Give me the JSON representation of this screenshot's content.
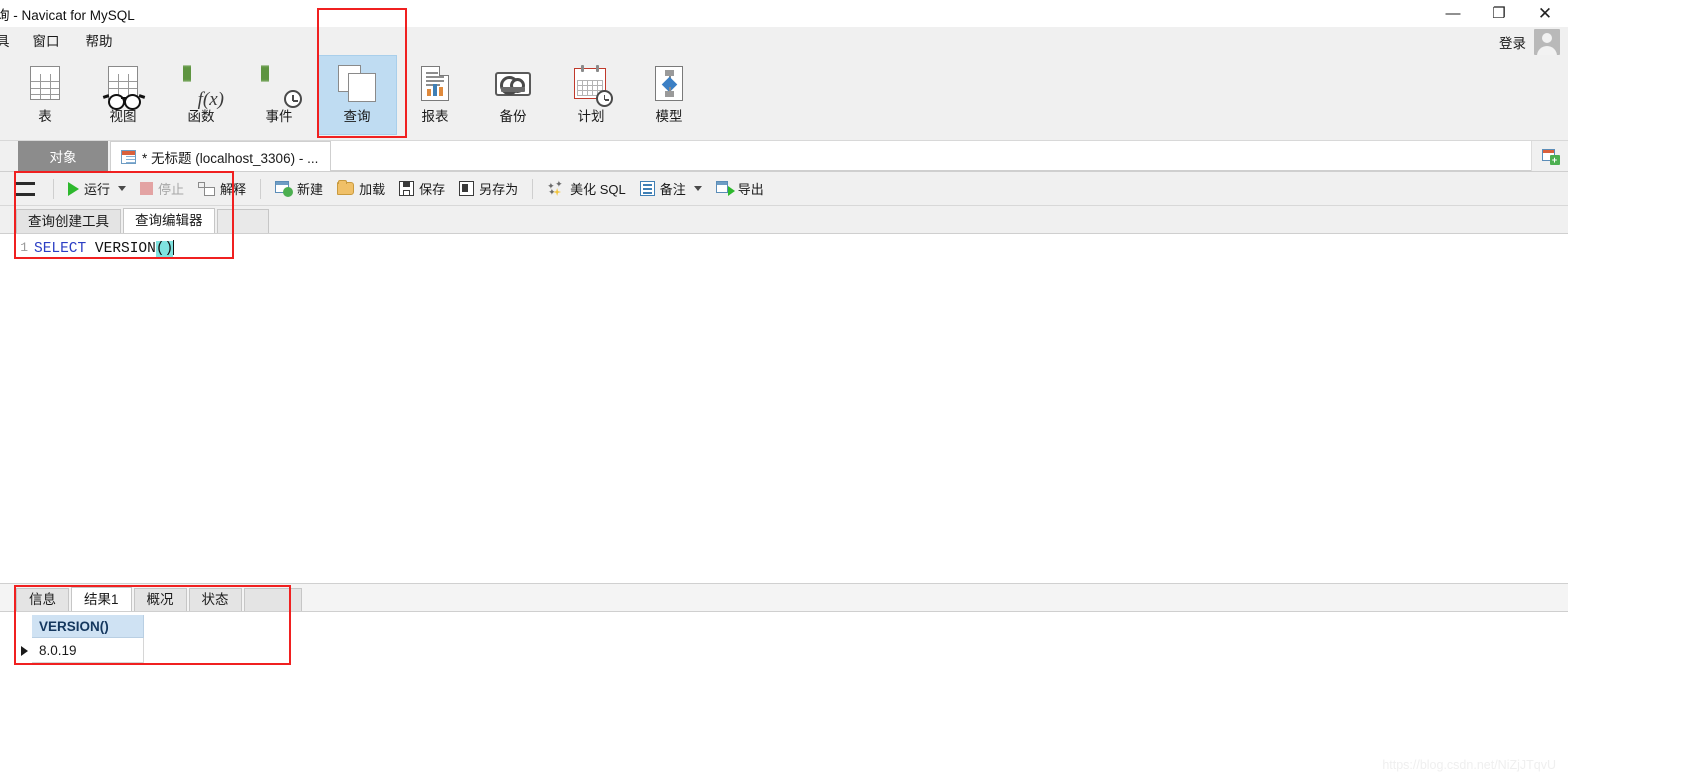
{
  "window": {
    "title": "询 - Navicat for MySQL",
    "minimize_label": "—",
    "maximize_label": "❐",
    "close_label": "✕"
  },
  "menubar": {
    "items": [
      {
        "label": "具"
      },
      {
        "label": "窗口"
      },
      {
        "label": "帮助"
      }
    ],
    "login_label": "登录"
  },
  "toolbar": {
    "items": [
      {
        "label": "表",
        "icon": "table-icon",
        "active": false
      },
      {
        "label": "视图",
        "icon": "view-glasses-icon",
        "active": false
      },
      {
        "label": "函数",
        "icon": "function-icon",
        "active": false
      },
      {
        "label": "事件",
        "icon": "event-clock-icon",
        "active": false
      },
      {
        "label": "查询",
        "icon": "query-icon",
        "active": true
      },
      {
        "label": "报表",
        "icon": "report-icon",
        "active": false
      },
      {
        "label": "备份",
        "icon": "backup-tape-icon",
        "active": false
      },
      {
        "label": "计划",
        "icon": "schedule-calendar-icon",
        "active": false
      },
      {
        "label": "模型",
        "icon": "model-icon",
        "active": false
      }
    ]
  },
  "tabstrip": {
    "object_tab": "对象",
    "connection_tab": "* 无标题 (localhost_3306) - ...",
    "add_tab_label": "+"
  },
  "query_toolbar": {
    "menu_label": "",
    "run_label": "运行",
    "stop_label": "停止",
    "explain_label": "解释",
    "new_label": "新建",
    "load_label": "加载",
    "save_label": "保存",
    "save_as_label": "另存为",
    "beautify_label": "美化 SQL",
    "note_label": "备注",
    "export_label": "导出"
  },
  "editor_tabs": {
    "items": [
      {
        "label": "查询创建工具",
        "active": false
      },
      {
        "label": "查询编辑器",
        "active": true
      }
    ]
  },
  "editor": {
    "line_number": "1",
    "sql_keyword": "SELECT",
    "sql_function": " VERSION",
    "sql_parens": "()"
  },
  "results": {
    "tabs": [
      {
        "label": "信息",
        "active": false
      },
      {
        "label": "结果1",
        "active": true
      },
      {
        "label": "概况",
        "active": false
      },
      {
        "label": "状态",
        "active": false
      }
    ],
    "columns": [
      "VERSION()"
    ],
    "rows": [
      [
        "8.0.19"
      ]
    ]
  },
  "watermark": {
    "text": "https://blog.csdn.net/NiZjJTqvU"
  },
  "colors": {
    "accent_blue": "#bfdcf2",
    "highlight_red": "#f02020",
    "keyword_blue": "#2b3ec4",
    "selection_cyan": "#7fe3e0",
    "header_blue": "#cfe2f3"
  }
}
